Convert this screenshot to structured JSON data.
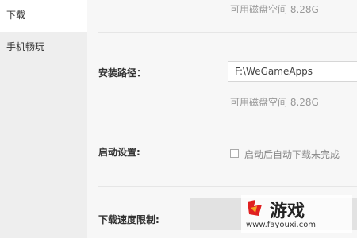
{
  "sidebar": {
    "items": [
      {
        "label": "下载"
      },
      {
        "label": "手机畅玩"
      }
    ]
  },
  "main": {
    "top_hint": "可用磁盘空间 8.28G",
    "install_path": {
      "label": "安装路径：",
      "value": "F:\\WeGameApps",
      "hint": "可用磁盘空间 8.28G"
    },
    "startup": {
      "label": "启动设置:",
      "checkbox_label": "启动后自动下载未完成"
    },
    "speed": {
      "label": "下载速度限制:"
    }
  },
  "watermark": {
    "title": "游戏",
    "url": "www.fayouxi.com"
  }
}
